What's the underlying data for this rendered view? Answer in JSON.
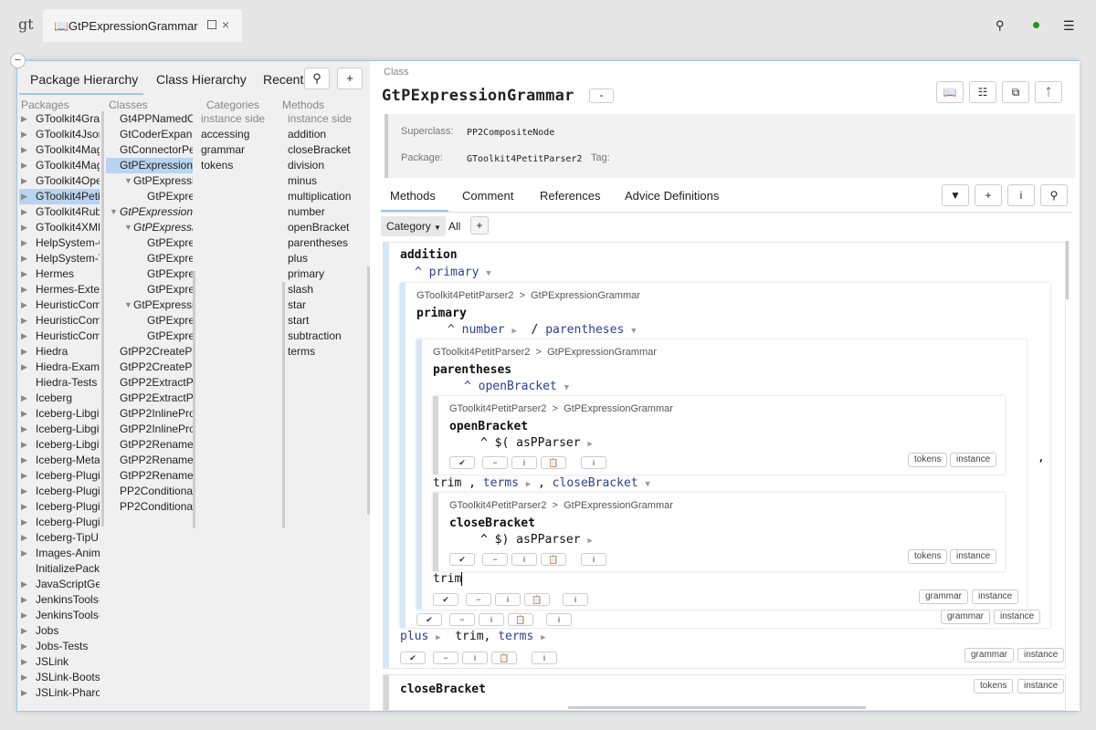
{
  "topbar": {
    "logo": "gt",
    "tab_icon": "📖",
    "tab_title": "GtPExpressionGrammar"
  },
  "nav": {
    "tabs": [
      "Package Hierarchy",
      "Class Hierarchy",
      "Recent"
    ],
    "headers": {
      "packages": "Packages",
      "classes": "Classes",
      "categories": "Categories",
      "methods": "Methods"
    },
    "packages": [
      "GToolkit4Grap",
      "GToolkit4Json",
      "GToolkit4Mag",
      "GToolkit4Mag",
      "GToolkit4Ope",
      "GToolkit4Peti",
      "GToolkit4Rub",
      "GToolkit4XML",
      "HelpSystem-C",
      "HelpSystem-T",
      "Hermes",
      "Hermes-Exten",
      "HeuristicCom",
      "HeuristicCom",
      "HeuristicCom",
      "Hiedra",
      "Hiedra-Examp",
      "Hiedra-Tests",
      "Iceberg",
      "Iceberg-Libgit",
      "Iceberg-Libgit",
      "Iceberg-Libgit",
      "Iceberg-Metac",
      "Iceberg-Plugin",
      "Iceberg-Plugin",
      "Iceberg-Plugin",
      "Iceberg-Plugin",
      "Iceberg-TipUI",
      "Images-Anima",
      "InitializePacka",
      "JavaScriptGen",
      "JenkinsTools-",
      "JenkinsTools-",
      "Jobs",
      "Jobs-Tests",
      "JSLink",
      "JSLink-Bootst",
      "JSLink-Pharo"
    ],
    "classes": [
      "Gt4PPNamedCh",
      "GtCoderExpand",
      "GtConnectorPe",
      "GtPExpressionG",
      "GtPExpressio",
      "GtPExpre",
      "GtPExpressionN",
      "GtPExpressio",
      "GtPExpre",
      "GtPExpre",
      "GtPExpre",
      "GtPExpre",
      "GtPExpressi",
      "GtPExpre",
      "GtPExpre",
      "GtPP2CreatePa",
      "GtPP2CreatePa",
      "GtPP2ExtractPr",
      "GtPP2ExtractPr",
      "GtPP2InlinePro",
      "GtPP2InlinePro",
      "GtPP2RenameC",
      "GtPP2RenameM",
      "GtPP2RenameV",
      "PP2Conditional",
      "PP2Conditional"
    ],
    "categories": [
      "instance side",
      "accessing",
      "grammar",
      "tokens"
    ],
    "methods": [
      "instance side",
      "addition",
      "closeBracket",
      "division",
      "minus",
      "multiplication",
      "number",
      "openBracket",
      "parentheses",
      "plus",
      "primary",
      "slash",
      "star",
      "start",
      "subtraction",
      "terms"
    ]
  },
  "coder": {
    "class_label": "Class",
    "class_name": "GtPExpressionGrammar",
    "collapse_label": "-",
    "superclass_key": "Superclass:",
    "superclass": "PP2CompositeNode",
    "package_key": "Package:",
    "package": "GToolkit4PetitParser2",
    "tag_key": "Tag:",
    "tabs": [
      "Methods",
      "Comment",
      "References",
      "Advice Definitions"
    ],
    "category_label": "Category",
    "category_value": "All",
    "plus": "+",
    "breadcrumb_pkg": "GToolkit4PetitParser2",
    "breadcrumb_sep": ">",
    "breadcrumb_cls": "GtPExpressionGrammar",
    "methods": {
      "addition": {
        "name": "addition",
        "line1": "^ primary",
        "tags": [
          "grammar",
          "instance"
        ],
        "line2_a": "plus",
        "line2_b": "trim,",
        "line2_c": "terms"
      },
      "primary": {
        "name": "primary",
        "line_ret": "^",
        "line_num": "number",
        "line_slash": "/",
        "line_par": "parentheses",
        "tags": [
          "grammar",
          "instance"
        ]
      },
      "parentheses": {
        "name": "parentheses",
        "line_ret": "^",
        "line_ob": "openBracket",
        "trail1": "trim ,",
        "trail_terms": "terms",
        "trail_comma": ",",
        "trail_cb": "closeBracket",
        "trail2": "trim",
        "tags": [
          "grammar",
          "instance"
        ]
      },
      "openBracket": {
        "name": "openBracket",
        "line": "^ $( asPParser",
        "tags": [
          "tokens",
          "instance"
        ]
      },
      "closeBracket_inner": {
        "name": "closeBracket",
        "line": "^ $) asPParser",
        "tags": [
          "tokens",
          "instance"
        ]
      },
      "closeBracket": {
        "name": "closeBracket",
        "tags": [
          "tokens",
          "instance"
        ]
      }
    },
    "trailing_comma": ","
  },
  "colors": {
    "accent": "#9ec8ee",
    "selection": "#b8d4ef",
    "keyword": "#2e3d99",
    "status": "#1c9a1c"
  }
}
